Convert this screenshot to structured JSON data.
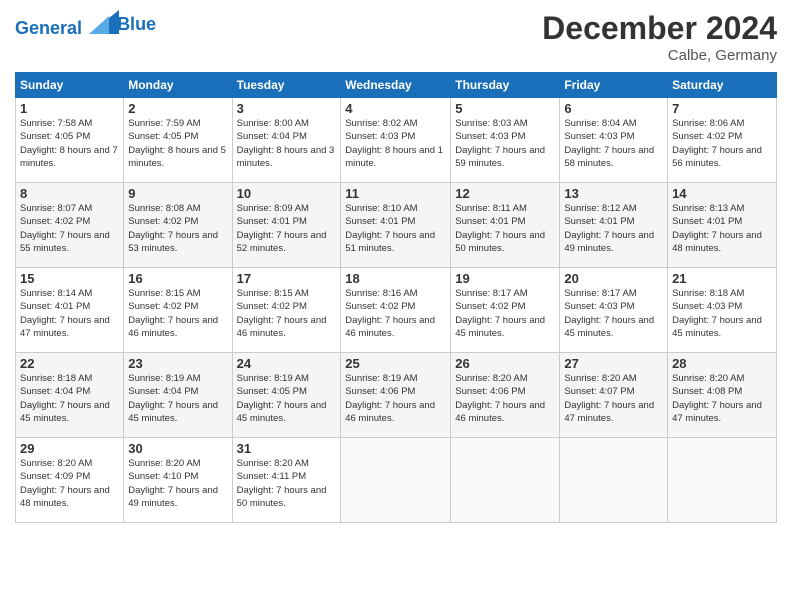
{
  "header": {
    "logo_line1": "General",
    "logo_line2": "Blue",
    "month": "December 2024",
    "location": "Calbe, Germany"
  },
  "days_of_week": [
    "Sunday",
    "Monday",
    "Tuesday",
    "Wednesday",
    "Thursday",
    "Friday",
    "Saturday"
  ],
  "weeks": [
    [
      {
        "day": "1",
        "sunrise": "7:58 AM",
        "sunset": "4:05 PM",
        "daylight": "8 hours and 7 minutes."
      },
      {
        "day": "2",
        "sunrise": "7:59 AM",
        "sunset": "4:05 PM",
        "daylight": "8 hours and 5 minutes."
      },
      {
        "day": "3",
        "sunrise": "8:00 AM",
        "sunset": "4:04 PM",
        "daylight": "8 hours and 3 minutes."
      },
      {
        "day": "4",
        "sunrise": "8:02 AM",
        "sunset": "4:03 PM",
        "daylight": "8 hours and 1 minute."
      },
      {
        "day": "5",
        "sunrise": "8:03 AM",
        "sunset": "4:03 PM",
        "daylight": "7 hours and 59 minutes."
      },
      {
        "day": "6",
        "sunrise": "8:04 AM",
        "sunset": "4:03 PM",
        "daylight": "7 hours and 58 minutes."
      },
      {
        "day": "7",
        "sunrise": "8:06 AM",
        "sunset": "4:02 PM",
        "daylight": "7 hours and 56 minutes."
      }
    ],
    [
      {
        "day": "8",
        "sunrise": "8:07 AM",
        "sunset": "4:02 PM",
        "daylight": "7 hours and 55 minutes."
      },
      {
        "day": "9",
        "sunrise": "8:08 AM",
        "sunset": "4:02 PM",
        "daylight": "7 hours and 53 minutes."
      },
      {
        "day": "10",
        "sunrise": "8:09 AM",
        "sunset": "4:01 PM",
        "daylight": "7 hours and 52 minutes."
      },
      {
        "day": "11",
        "sunrise": "8:10 AM",
        "sunset": "4:01 PM",
        "daylight": "7 hours and 51 minutes."
      },
      {
        "day": "12",
        "sunrise": "8:11 AM",
        "sunset": "4:01 PM",
        "daylight": "7 hours and 50 minutes."
      },
      {
        "day": "13",
        "sunrise": "8:12 AM",
        "sunset": "4:01 PM",
        "daylight": "7 hours and 49 minutes."
      },
      {
        "day": "14",
        "sunrise": "8:13 AM",
        "sunset": "4:01 PM",
        "daylight": "7 hours and 48 minutes."
      }
    ],
    [
      {
        "day": "15",
        "sunrise": "8:14 AM",
        "sunset": "4:01 PM",
        "daylight": "7 hours and 47 minutes."
      },
      {
        "day": "16",
        "sunrise": "8:15 AM",
        "sunset": "4:02 PM",
        "daylight": "7 hours and 46 minutes."
      },
      {
        "day": "17",
        "sunrise": "8:15 AM",
        "sunset": "4:02 PM",
        "daylight": "7 hours and 46 minutes."
      },
      {
        "day": "18",
        "sunrise": "8:16 AM",
        "sunset": "4:02 PM",
        "daylight": "7 hours and 46 minutes."
      },
      {
        "day": "19",
        "sunrise": "8:17 AM",
        "sunset": "4:02 PM",
        "daylight": "7 hours and 45 minutes."
      },
      {
        "day": "20",
        "sunrise": "8:17 AM",
        "sunset": "4:03 PM",
        "daylight": "7 hours and 45 minutes."
      },
      {
        "day": "21",
        "sunrise": "8:18 AM",
        "sunset": "4:03 PM",
        "daylight": "7 hours and 45 minutes."
      }
    ],
    [
      {
        "day": "22",
        "sunrise": "8:18 AM",
        "sunset": "4:04 PM",
        "daylight": "7 hours and 45 minutes."
      },
      {
        "day": "23",
        "sunrise": "8:19 AM",
        "sunset": "4:04 PM",
        "daylight": "7 hours and 45 minutes."
      },
      {
        "day": "24",
        "sunrise": "8:19 AM",
        "sunset": "4:05 PM",
        "daylight": "7 hours and 45 minutes."
      },
      {
        "day": "25",
        "sunrise": "8:19 AM",
        "sunset": "4:06 PM",
        "daylight": "7 hours and 46 minutes."
      },
      {
        "day": "26",
        "sunrise": "8:20 AM",
        "sunset": "4:06 PM",
        "daylight": "7 hours and 46 minutes."
      },
      {
        "day": "27",
        "sunrise": "8:20 AM",
        "sunset": "4:07 PM",
        "daylight": "7 hours and 47 minutes."
      },
      {
        "day": "28",
        "sunrise": "8:20 AM",
        "sunset": "4:08 PM",
        "daylight": "7 hours and 47 minutes."
      }
    ],
    [
      {
        "day": "29",
        "sunrise": "8:20 AM",
        "sunset": "4:09 PM",
        "daylight": "7 hours and 48 minutes."
      },
      {
        "day": "30",
        "sunrise": "8:20 AM",
        "sunset": "4:10 PM",
        "daylight": "7 hours and 49 minutes."
      },
      {
        "day": "31",
        "sunrise": "8:20 AM",
        "sunset": "4:11 PM",
        "daylight": "7 hours and 50 minutes."
      },
      null,
      null,
      null,
      null
    ]
  ]
}
